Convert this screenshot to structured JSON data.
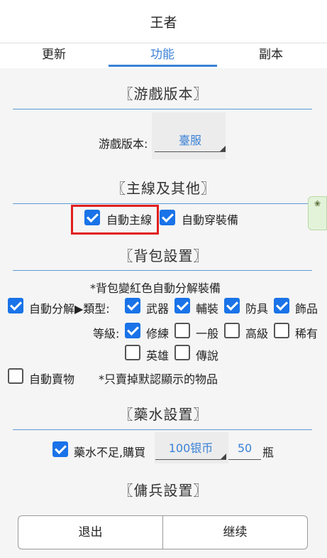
{
  "header": {
    "title": "王者"
  },
  "tabs": [
    {
      "label": "更新"
    },
    {
      "label": "功能"
    },
    {
      "label": "副本"
    }
  ],
  "game_version": {
    "section_title": "〖游戲版本〗",
    "label": "游戲版本:",
    "value": "臺服"
  },
  "main_line": {
    "section_title": "〖主線及其他〗",
    "auto_main": {
      "label": "自動主線",
      "checked": true
    },
    "auto_equip": {
      "label": "自動穿裝備",
      "checked": true
    },
    "side_icon": "❀"
  },
  "backpack": {
    "section_title": "〖背包設置〗",
    "note": "*背包變紅色自動分解裝備",
    "auto_decompose": {
      "label": "自動分解▶類型:",
      "checked": true
    },
    "types": [
      {
        "label": "武器",
        "checked": true
      },
      {
        "label": "輔裝",
        "checked": true
      },
      {
        "label": "防具",
        "checked": true
      },
      {
        "label": "飾品",
        "checked": true
      }
    ],
    "grade_label": "等級:",
    "grades": [
      {
        "label": "修練",
        "checked": true
      },
      {
        "label": "一般",
        "checked": false
      },
      {
        "label": "高級",
        "checked": false
      },
      {
        "label": "稀有",
        "checked": false
      },
      {
        "label": "英雄",
        "checked": false
      },
      {
        "label": "傳說",
        "checked": false
      }
    ],
    "auto_sell": {
      "label": "自動賣物",
      "checked": false
    },
    "sell_note": "*只賣掉默認顯示的物品"
  },
  "potion": {
    "section_title": "〖藥水設置〗",
    "auto_buy": {
      "label": "藥水不足,購買",
      "checked": true
    },
    "currency_value": "100银币",
    "qty_value": "50",
    "unit": "瓶"
  },
  "mercenary": {
    "section_title": "〖傭兵設置〗"
  },
  "footer": {
    "exit_label": "退出",
    "continue_label": "继续"
  }
}
